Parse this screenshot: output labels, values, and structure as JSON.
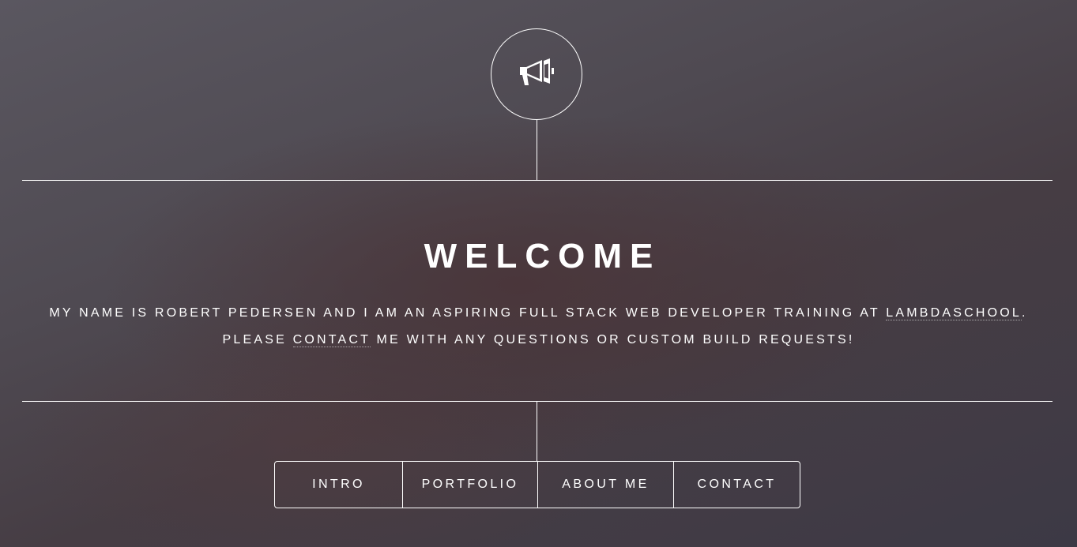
{
  "header": {
    "icon": "megaphone-icon"
  },
  "main": {
    "title": "WELCOME",
    "intro": {
      "line1_before": "MY NAME IS ROBERT PEDERSEN AND I AM AN ASPIRING FULL STACK WEB DEVELOPER TRAINING AT ",
      "line1_link": "LAMBDASCHOOL",
      "line1_after": ".",
      "line2_before": "PLEASE ",
      "line2_link": "CONTACT",
      "line2_after": " ME WITH ANY QUESTIONS OR CUSTOM BUILD REQUESTS!"
    }
  },
  "nav": {
    "items": [
      {
        "label": "INTRO"
      },
      {
        "label": "PORTFOLIO"
      },
      {
        "label": "ABOUT ME"
      },
      {
        "label": "CONTACT"
      }
    ]
  },
  "colors": {
    "text": "#ffffff",
    "background": "#4a4450"
  }
}
